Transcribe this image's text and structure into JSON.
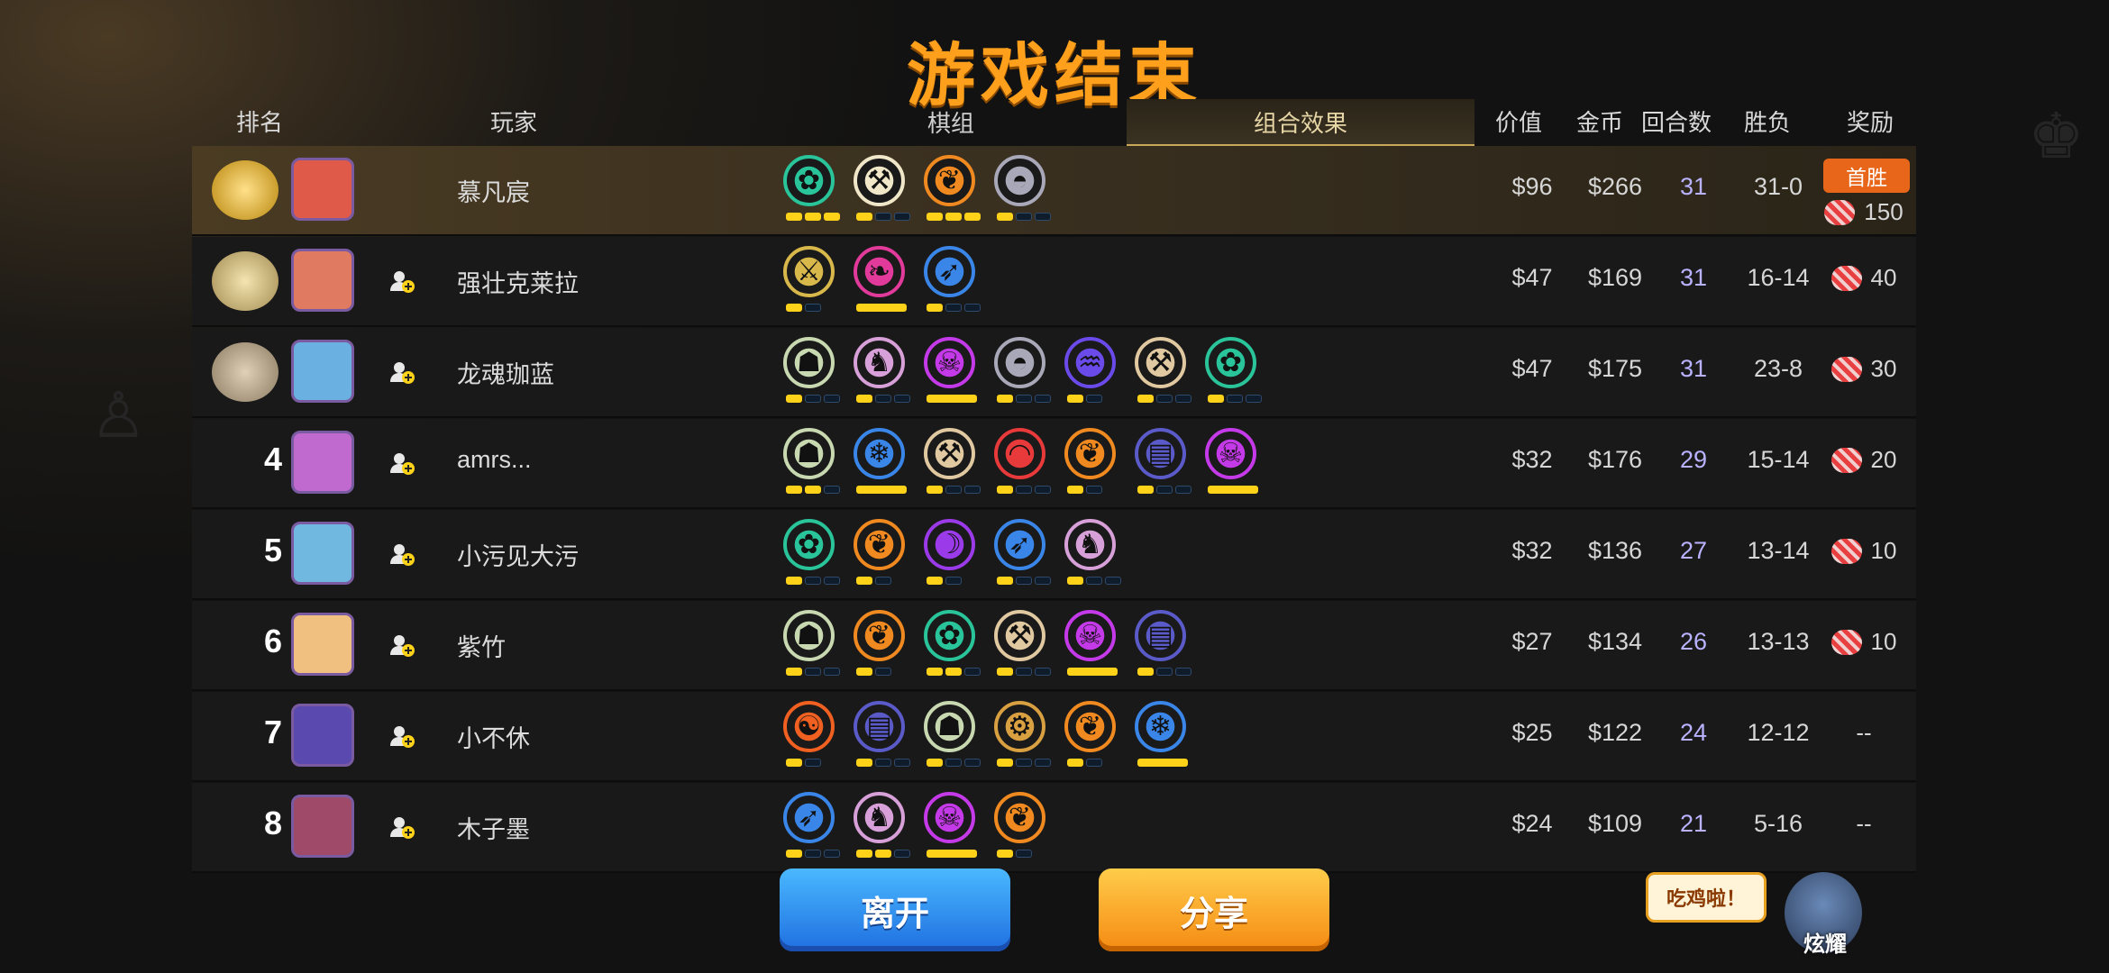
{
  "title": "游戏结束",
  "headers": {
    "rank": "排名",
    "player": "玩家",
    "pieces_tab": "棋组",
    "combo_tab": "组合效果",
    "value": "价值",
    "gold": "金币",
    "rounds": "回合数",
    "wl": "胜负",
    "reward": "奖励"
  },
  "rows": [
    {
      "rank": "",
      "name": "慕凡宸",
      "value": "$96",
      "gold": "$266",
      "rounds": "31",
      "wl": "31-0",
      "reward": "150",
      "first_win": "首胜"
    },
    {
      "rank": "",
      "name": "强壮克莱拉",
      "value": "$47",
      "gold": "$169",
      "rounds": "31",
      "wl": "16-14",
      "reward": "40"
    },
    {
      "rank": "",
      "name": "龙魂珈蓝",
      "value": "$47",
      "gold": "$175",
      "rounds": "31",
      "wl": "23-8",
      "reward": "30"
    },
    {
      "rank": "4",
      "name": "amrs...",
      "value": "$32",
      "gold": "$176",
      "rounds": "29",
      "wl": "15-14",
      "reward": "20"
    },
    {
      "rank": "5",
      "name": "小污见大污",
      "value": "$32",
      "gold": "$136",
      "rounds": "27",
      "wl": "13-14",
      "reward": "10"
    },
    {
      "rank": "6",
      "name": "紫竹",
      "value": "$27",
      "gold": "$134",
      "rounds": "26",
      "wl": "13-13",
      "reward": "10"
    },
    {
      "rank": "7",
      "name": "小不休",
      "value": "$25",
      "gold": "$122",
      "rounds": "24",
      "wl": "12-12",
      "reward": "--"
    },
    {
      "rank": "8",
      "name": "木子墨",
      "value": "$24",
      "gold": "$109",
      "rounds": "21",
      "wl": "5-16",
      "reward": "--"
    }
  ],
  "buttons": {
    "leave": "离开",
    "share": "分享"
  },
  "bubble": "吃鸡啦！",
  "mascot_label": "炫耀",
  "colors": {
    "title": "#ffa01c",
    "rounds": "#b9b3ff",
    "leave": "#2a8ef0",
    "share": "#f9a41e"
  }
}
